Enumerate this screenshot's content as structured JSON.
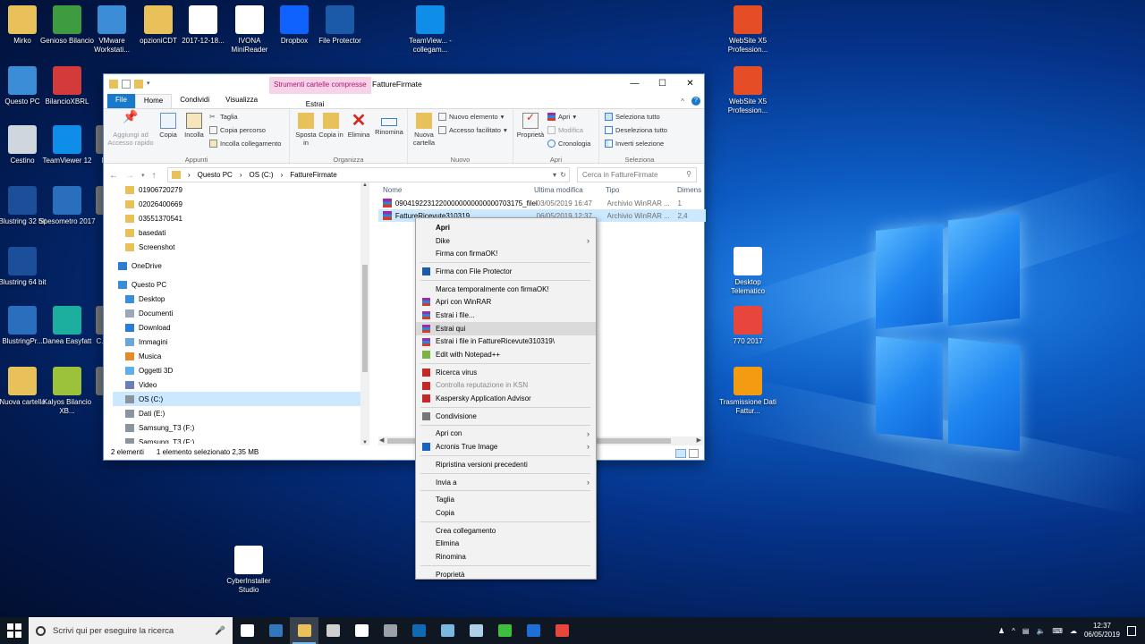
{
  "colors": {
    "accent": "#1979ca",
    "selection": "#cce8ff",
    "context_tab": "#b4146e"
  },
  "desktop_icons": [
    {
      "label": "Mirko",
      "icon": "folder-user-icon",
      "color": "#e8c15a"
    },
    {
      "label": "Genioso Bilancio",
      "icon": "genioso-icon",
      "color": "#3f9b3f"
    },
    {
      "label": "VMware Workstati...",
      "icon": "vmware-icon",
      "color": "#3b8dd8"
    },
    {
      "label": "opzioniCDT",
      "icon": "zip-folder-icon",
      "color": "#e8c15a"
    },
    {
      "label": "2017-12-18...",
      "icon": "pdf-icon",
      "color": "#ffffff"
    },
    {
      "label": "IVONA MiniReader",
      "icon": "ivona-icon",
      "color": "#ffffff"
    },
    {
      "label": "Dropbox",
      "icon": "dropbox-icon",
      "color": "#0f62fe"
    },
    {
      "label": "File Protector",
      "icon": "file-protector-icon",
      "color": "#1b5aa6"
    },
    {
      "label": "TeamView... - collegam...",
      "icon": "teamviewer-icon",
      "color": "#0e8ee9"
    },
    {
      "label": "WebSite X5 Profession...",
      "icon": "websitex5-icon",
      "color": "#e44d26"
    },
    {
      "label": "Questo PC",
      "icon": "computer-icon",
      "color": "#3b8dd8"
    },
    {
      "label": "BilancioXBRL",
      "icon": "chart-icon",
      "color": "#d33b3b"
    },
    {
      "label": "WebSite X5 Profession...",
      "icon": "websitex5-icon",
      "color": "#e44d26"
    },
    {
      "label": "Cestino",
      "icon": "recycle-bin-icon",
      "color": "#cfd6de"
    },
    {
      "label": "TeamViewer 12",
      "icon": "teamviewer-icon",
      "color": "#0e8ee9"
    },
    {
      "label": "Pro...",
      "icon": "app-icon",
      "color": "#777777"
    },
    {
      "label": "Blustring 32 bit",
      "icon": "blustring-icon",
      "color": "#1b4f9a"
    },
    {
      "label": "Spesometro 2017",
      "icon": "spesometro-icon",
      "color": "#2a6fbe"
    },
    {
      "label": "Bl...",
      "icon": "app-icon",
      "color": "#777777"
    },
    {
      "label": "Blustring 64 bit",
      "icon": "blustring-icon",
      "color": "#1b4f9a"
    },
    {
      "label": "BlustringPr...",
      "icon": "blustring-pro-icon",
      "color": "#2a6fbe"
    },
    {
      "label": "Danea Easyfatt",
      "icon": "danea-icon",
      "color": "#1cae9e"
    },
    {
      "label": "C... Sp...",
      "icon": "app-icon",
      "color": "#777777"
    },
    {
      "label": "Nuova cartella",
      "icon": "folder-icon",
      "color": "#e8c15a"
    },
    {
      "label": "Kalyos Bilancio XB...",
      "icon": "kalyos-icon",
      "color": "#9cc23c"
    },
    {
      "label": "Mc...",
      "icon": "app-icon",
      "color": "#777777"
    },
    {
      "label": "Desktop Telematico",
      "icon": "desktop-telematico-icon",
      "color": "#ffffff"
    },
    {
      "label": "770 2017",
      "icon": "chrome-icon",
      "color": "#e8453c"
    },
    {
      "label": "Trasmissione Dati Fattur...",
      "icon": "globe-icon",
      "color": "#f39c12"
    },
    {
      "label": "CyberInstaller Studio",
      "icon": "cyberinstaller-icon",
      "color": "#ffffff"
    }
  ],
  "explorer": {
    "title": "FattureFirmate",
    "context_tab_group": "Strumenti cartelle compresse",
    "tabs": [
      "File",
      "Home",
      "Condividi",
      "Visualizza"
    ],
    "context_tab": "Estrai",
    "ribbon": {
      "appunti": {
        "label": "Appunti",
        "pin": "Aggiungi ad Accesso rapido",
        "copy": "Copia",
        "paste": "Incolla",
        "cut": "Taglia",
        "copy_path": "Copia percorso",
        "paste_link": "Incolla collegamento"
      },
      "organizza": {
        "label": "Organizza",
        "move": "Sposta in",
        "copy_to": "Copia in",
        "delete": "Elimina",
        "rename": "Rinomina"
      },
      "nuovo": {
        "label": "Nuovo",
        "new_folder": "Nuova cartella",
        "new_item": "Nuovo elemento",
        "easy_access": "Accesso facilitato"
      },
      "apri": {
        "label": "Apri",
        "properties": "Proprietà",
        "open": "Apri",
        "edit": "Modifica",
        "history": "Cronologia"
      },
      "seleziona": {
        "label": "Seleziona",
        "select_all": "Seleziona tutto",
        "select_none": "Deseleziona tutto",
        "invert": "Inverti selezione"
      }
    },
    "breadcrumb": [
      "Questo PC",
      "OS (C:)",
      "FattureFirmate"
    ],
    "search_placeholder": "Cerca in FattureFirmate",
    "nav": [
      {
        "label": "01906720279",
        "icon": "folder-icon"
      },
      {
        "label": "02026400669",
        "icon": "folder-icon"
      },
      {
        "label": "03551370541",
        "icon": "folder-icon"
      },
      {
        "label": "basedati",
        "icon": "folder-icon"
      },
      {
        "label": "Screenshot",
        "icon": "folder-icon"
      },
      {
        "label": "OneDrive",
        "icon": "onedrive-icon"
      },
      {
        "label": "Questo PC",
        "icon": "computer-icon"
      },
      {
        "label": "Desktop",
        "icon": "desktop-folder-icon"
      },
      {
        "label": "Documenti",
        "icon": "documents-icon"
      },
      {
        "label": "Download",
        "icon": "download-icon"
      },
      {
        "label": "Immagini",
        "icon": "pictures-icon"
      },
      {
        "label": "Musica",
        "icon": "music-icon"
      },
      {
        "label": "Oggetti 3D",
        "icon": "objects-3d-icon"
      },
      {
        "label": "Video",
        "icon": "video-icon"
      },
      {
        "label": "OS (C:)",
        "icon": "drive-icon"
      },
      {
        "label": "Dati (E:)",
        "icon": "drive-icon"
      },
      {
        "label": "Samsung_T3 (F:)",
        "icon": "drive-icon"
      },
      {
        "label": "Samsung_T3 (F:)",
        "icon": "drive-icon"
      }
    ],
    "columns": [
      "Nome",
      "Ultima modifica",
      "Tipo",
      "Dimens"
    ],
    "files": [
      {
        "name": "09041922312200000000000000703175_filePr...",
        "modified": "03/05/2019 16:47",
        "type": "Archivio WinRAR ...",
        "size": "1"
      },
      {
        "name": "FattureRicevute310319",
        "modified": "06/05/2019 12:37",
        "type": "Archivio WinRAR ...",
        "size": "2,4"
      }
    ],
    "status": {
      "count": "2 elementi",
      "selection": "1 elemento selezionato  2,35 MB"
    }
  },
  "context_menu": [
    {
      "label": "Apri",
      "bold": true
    },
    {
      "label": "Dike",
      "submenu": true
    },
    {
      "label": "Firma con firmaOK!"
    },
    {
      "sep": true
    },
    {
      "label": "Firma con File Protector",
      "icon": "file-protector-icon"
    },
    {
      "sep": true
    },
    {
      "label": "Marca temporalmente con firmaOK!"
    },
    {
      "label": "Apri con WinRAR",
      "icon": "winrar-icon"
    },
    {
      "label": "Estrai i file...",
      "icon": "winrar-icon"
    },
    {
      "label": "Estrai qui",
      "icon": "winrar-icon",
      "highlight": true
    },
    {
      "label": "Estrai i file in FattureRicevute310319\\",
      "icon": "winrar-icon"
    },
    {
      "label": "Edit with Notepad++",
      "icon": "notepad-plus-icon"
    },
    {
      "sep": true
    },
    {
      "label": "Ricerca virus",
      "icon": "kaspersky-icon"
    },
    {
      "label": "Controlla reputazione in KSN",
      "icon": "kaspersky-icon",
      "disabled": true
    },
    {
      "label": "Kaspersky Application Advisor",
      "icon": "kaspersky-icon"
    },
    {
      "sep": true
    },
    {
      "label": "Condivisione",
      "icon": "share-icon"
    },
    {
      "sep": true
    },
    {
      "label": "Apri con",
      "submenu": true
    },
    {
      "label": "Acronis True Image",
      "icon": "acronis-icon",
      "submenu": true
    },
    {
      "sep": true
    },
    {
      "label": "Ripristina versioni precedenti"
    },
    {
      "sep": true
    },
    {
      "label": "Invia a",
      "submenu": true
    },
    {
      "sep": true
    },
    {
      "label": "Taglia"
    },
    {
      "label": "Copia"
    },
    {
      "sep": true
    },
    {
      "label": "Crea collegamento"
    },
    {
      "label": "Elimina"
    },
    {
      "label": "Rinomina"
    },
    {
      "sep": true
    },
    {
      "label": "Proprietà"
    }
  ],
  "taskbar": {
    "search_placeholder": "Scrivi qui per eseguire la ricerca",
    "apps": [
      "task-view-icon",
      "edge-icon",
      "file-explorer-icon",
      "store-icon",
      "mail-icon",
      "calculator-icon",
      "outlook-icon",
      "app-icon",
      "notepad-icon",
      "camtasia-icon",
      "blustring-icon",
      "camtasia-recorder-icon"
    ],
    "time": "12:37",
    "date": "06/05/2019"
  }
}
